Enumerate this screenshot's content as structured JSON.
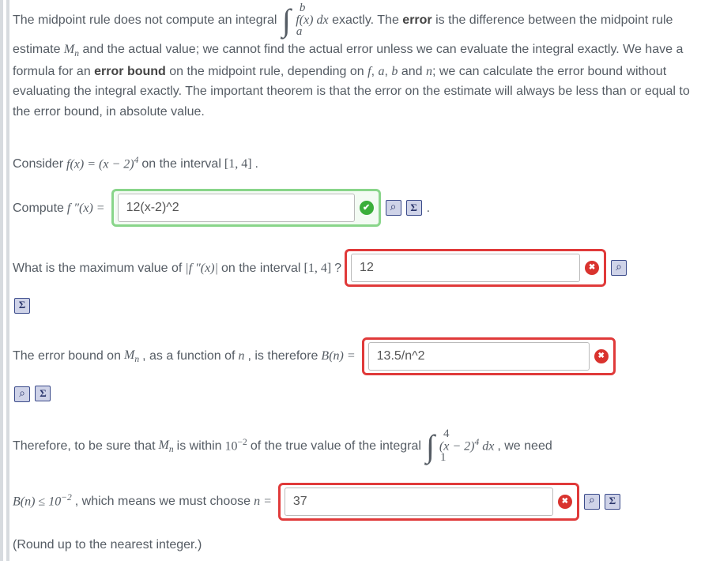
{
  "intro": {
    "pre": "The midpoint rule does not compute an integral ",
    "int_upper": "b",
    "int_lower": "a",
    "int_body": "f(x) dx",
    "post_exactly": " exactly.  The ",
    "error_word": "error",
    "post_error": " is the difference between the midpoint rule estimate ",
    "Mn": "M",
    "Mn_sub": "n",
    "after_Mn": " and the actual value; we cannot find the actual error unless we can evaluate the integral exactly.  We have a formula for an ",
    "error_bound_word": "error bound",
    "after_eb": " on the midpoint rule, depending on ",
    "f": "f",
    "comma1": ", ",
    "a": "a",
    "comma2": ", ",
    "b": "b",
    "and": " and ",
    "n": "n",
    "tail": "; we can calculate the error bound without evaluating the integral exactly.  The important theorem is that the error on the estimate will always be less than or equal to the error bound, in absolute value."
  },
  "q1": {
    "pre": "Consider ",
    "fx": "f(x) = (x − 2)",
    "exp": "4",
    "mid": " on the interval ",
    "interval": "[1, 4]",
    "dot": "."
  },
  "q2": {
    "pre": "Compute ",
    "f2": "f ″(x) =",
    "value": "12(x-2)^2",
    "status": "correct",
    "dot": "."
  },
  "q3": {
    "pre": "What is the maximum value of ",
    "abs_f2": "|f ″(x)|",
    "mid": " on the interval ",
    "interval": "[1, 4]",
    "qmark": " ? ",
    "value": "12",
    "status": "wrong"
  },
  "q4": {
    "pre": "The error bound on ",
    "Mn": "M",
    "Mn_sub": "n",
    "mid": ", as a function of ",
    "n": "n",
    "post": ", is therefore ",
    "Bn": "B(n) =",
    "value": "13.5/n^2",
    "status": "wrong"
  },
  "q5": {
    "line1_pre": "Therefore, to be sure that ",
    "Mn": "M",
    "Mn_sub": "n",
    "line1_mid": " is within ",
    "ten": "10",
    "exp_neg2": "−2",
    "line1_post": " of the true value of the integral ",
    "int_upper": "4",
    "int_lower": "1",
    "int_body_a": "(x − 2)",
    "int_body_exp": "4",
    "int_body_b": " dx",
    "line1_tail": ", we need",
    "line2_pre": "B(n) ≤ 10",
    "line2_mid": ", which means we must choose ",
    "n_eq": "n =",
    "value": "37",
    "status": "wrong",
    "round": "(Round up to the nearest integer.)"
  }
}
